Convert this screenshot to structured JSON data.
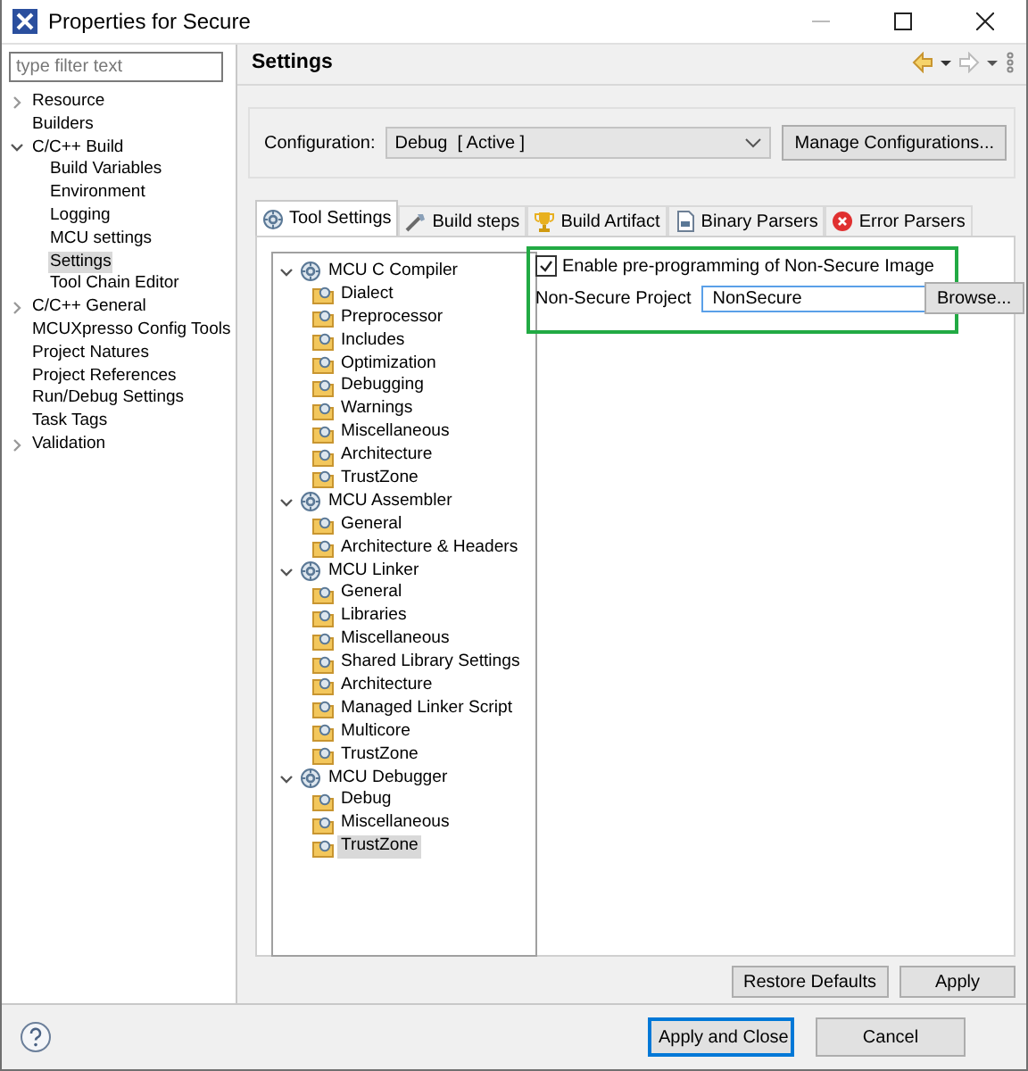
{
  "window": {
    "title": "Properties for Secure"
  },
  "filter": {
    "placeholder": "type filter text"
  },
  "nav": [
    {
      "label": "Resource",
      "expanded": false,
      "selected": false
    },
    {
      "label": "Builders",
      "selected": false
    },
    {
      "label": "C/C++ Build",
      "expanded": true,
      "selected": false,
      "children": [
        {
          "label": "Build Variables",
          "selected": false
        },
        {
          "label": "Environment",
          "selected": false
        },
        {
          "label": "Logging",
          "selected": false
        },
        {
          "label": "MCU settings",
          "selected": false
        },
        {
          "label": "Settings",
          "selected": true
        },
        {
          "label": "Tool Chain Editor",
          "selected": false
        }
      ]
    },
    {
      "label": "C/C++ General",
      "expanded": false,
      "selected": false
    },
    {
      "label": "MCUXpresso Config Tools",
      "selected": false
    },
    {
      "label": "Project Natures",
      "selected": false
    },
    {
      "label": "Project References",
      "selected": false
    },
    {
      "label": "Run/Debug Settings",
      "selected": false
    },
    {
      "label": "Task Tags",
      "selected": false
    },
    {
      "label": "Validation",
      "expanded": false,
      "selected": false
    }
  ],
  "page": {
    "title": "Settings"
  },
  "configuration": {
    "label": "Configuration:",
    "value": "Debug  [ Active ]",
    "button": "Manage Configurations..."
  },
  "tabs": [
    {
      "label": "Tool Settings",
      "kind": "gear",
      "selected": true
    },
    {
      "label": "Build steps",
      "kind": "wand",
      "selected": false
    },
    {
      "label": "Build Artifact",
      "kind": "trophy",
      "selected": false
    },
    {
      "label": "Binary Parsers",
      "kind": "document",
      "selected": false
    },
    {
      "label": "Error Parsers",
      "kind": "error",
      "selected": false
    }
  ],
  "tool_tree": [
    {
      "label": "MCU C Compiler",
      "expanded": true,
      "children": [
        {
          "label": "Dialect",
          "selected": false
        },
        {
          "label": "Preprocessor",
          "selected": false
        },
        {
          "label": "Includes",
          "selected": false
        },
        {
          "label": "Optimization",
          "selected": false
        },
        {
          "label": "Debugging",
          "selected": false
        },
        {
          "label": "Warnings",
          "selected": false
        },
        {
          "label": "Miscellaneous",
          "selected": false
        },
        {
          "label": "Architecture",
          "selected": false
        },
        {
          "label": "TrustZone",
          "selected": false
        }
      ]
    },
    {
      "label": "MCU Assembler",
      "expanded": true,
      "children": [
        {
          "label": "General",
          "selected": false
        },
        {
          "label": "Architecture & Headers",
          "selected": false
        }
      ]
    },
    {
      "label": "MCU Linker",
      "expanded": true,
      "children": [
        {
          "label": "General",
          "selected": false
        },
        {
          "label": "Libraries",
          "selected": false
        },
        {
          "label": "Miscellaneous",
          "selected": false
        },
        {
          "label": "Shared Library Settings",
          "selected": false
        },
        {
          "label": "Architecture",
          "selected": false
        },
        {
          "label": "Managed Linker Script",
          "selected": false
        },
        {
          "label": "Multicore",
          "selected": false
        },
        {
          "label": "TrustZone",
          "selected": false
        }
      ]
    },
    {
      "label": "MCU Debugger",
      "expanded": true,
      "children": [
        {
          "label": "Debug",
          "selected": false
        },
        {
          "label": "Miscellaneous",
          "selected": false
        },
        {
          "label": "TrustZone",
          "selected": true
        }
      ]
    }
  ],
  "options": {
    "enable": {
      "label": "Enable pre-programming of Non-Secure Image",
      "checked": true
    },
    "project": {
      "label": "Non-Secure Project",
      "value": "NonSecure"
    },
    "browse": "Browse..."
  },
  "page_buttons": [
    "Restore Defaults",
    "Apply"
  ],
  "footer": {
    "buttons": [
      {
        "label": "Apply and Close",
        "default": true
      },
      {
        "label": "Cancel",
        "default": false
      }
    ]
  }
}
